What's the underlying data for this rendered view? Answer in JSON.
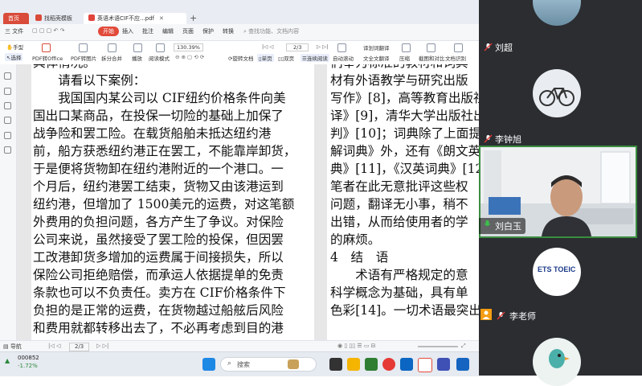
{
  "tabs": {
    "home": "首页",
    "find_template": "找稻壳模板",
    "doc": "英语术语CIF不应...pdf"
  },
  "menu": {
    "file": "三 文件",
    "open_btn": "开始",
    "items": [
      "插入",
      "批注",
      "编辑",
      "页面",
      "保护",
      "转换"
    ],
    "search": "查找功能、文档内容"
  },
  "toolbar": {
    "hand": "手型",
    "select": "选择",
    "pdf_office": "PDF转Office",
    "pdf_img": "PDF转图片",
    "split": "拆分合并",
    "play": "播放",
    "read": "阅读模式",
    "zoom": "130.39%",
    "page_no": "2/3",
    "rotate": "旋转文档",
    "single": "单页",
    "double": "双页",
    "continuous": "连续阅读",
    "auto_scroll": "自动滚动",
    "translate": "划词翻译",
    "full_translate": "全文翻译",
    "compress": "压缩",
    "compare": "截图和对比",
    "ocr": "文档识别"
  },
  "left_page_lines": [
    "具体情况。",
    "　　请看以下案例：",
    "　　我国国内某公司以 CIF纽约价格条件向美",
    "国出口某商品，在投保一切险的基础上加保了",
    "战争险和罢工险。在载货船舶未抵达纽约港",
    "前，船方获悉纽约港正在罢工，不能靠岸卸货，",
    "于是便将货物卸在纽约港附近的一个港口。一",
    "个月后，纽约港罢工结束，货物又由该港运到",
    "纽约港，但增加了 1500美元的运费，对这笔额",
    "外费用的负担问题，各方产生了争议。对保险",
    "公司来说，虽然接受了罢工险的投保，但因罢",
    "工改港卸货多增加的运费属于间接损失，所以",
    "保险公司拒绝赔偿，而承运人依据提单的免责",
    "条款也可以不负责任。卖方在 CIF价格条件下",
    "负担的是正常的运费，在货物越过船舷后风险",
    "和费用就都转移出去了，不必再考虑到目的港"
  ],
  "right_page_lines": [
    "们奉为标准的教材和词典",
    "材有外语教学与研究出版",
    "写作》[8]，高等教育出版社",
    "译》[9]，清华大学出版社出",
    "判》[10]；词典除了上面提",
    "解词典》外，还有《朗文英",
    "典》[11]，《汉英词典》[12]，",
    "笔者在此无意批评这些权",
    "问题，翻译无小事，稍不",
    "出错，从而给使用者的学",
    "的麻烦。",
    "4　结　语",
    "　　术语有严格规定的意",
    "科学概念为基础，具有单",
    "色彩[14]。一切术语最突出"
  ],
  "status": {
    "nav": "导航",
    "page": "2/3"
  },
  "taskbar": {
    "stock_code": "000852",
    "stock_change": "-1.72%",
    "search_placeholder": "搜索"
  },
  "participants": [
    {
      "name": "刘超"
    },
    {
      "name": "李钟旭"
    },
    {
      "name": "刘白玉"
    },
    {
      "name": "李老师",
      "logo": "ETS TOEIC"
    }
  ],
  "colors": {
    "accent_red": "#e24a3a",
    "panel_bg": "#2b2d31",
    "active_speaker": "#3a8d3f"
  }
}
